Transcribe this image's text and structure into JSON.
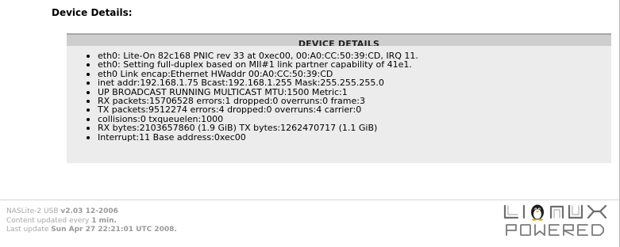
{
  "section_heading": "Device Details:",
  "box": {
    "title": "DEVICE DETAILS",
    "items": [
      "eth0: Lite-On 82c168 PNIC rev 33 at 0xec00, 00:A0:CC:50:39:CD, IRQ 11.",
      "eth0: Setting full-duplex based on MII#1 link partner capability of 41e1.",
      "eth0 Link encap:Ethernet HWaddr 00:A0:CC:50:39:CD",
      "inet addr:192.168.1.75 Bcast:192.168.1.255 Mask:255.255.255.0",
      "UP BROADCAST RUNNING MULTICAST MTU:1500 Metric:1",
      "RX packets:15706528 errors:1 dropped:0 overruns:0 frame:3",
      "TX packets:9512274 errors:4 dropped:0 overruns:4 carrier:0",
      "collisions:0 txqueuelen:1000",
      "RX bytes:2103657860 (1.9 GiB) TX bytes:1262470717 (1.1 GiB)",
      "Interrupt:11 Base address:0xec00"
    ]
  },
  "footer": {
    "product_prefix": "NASLite-2 USB",
    "version": "v2.03 12-2006",
    "update_prefix": "Content updated every",
    "update_interval": "1 min.",
    "last_update_prefix": "Last update",
    "last_update_value": "Sun Apr 27 22:21:01 UTC 2008."
  },
  "logo": {
    "top_text": "LINUX",
    "bottom_text": "POWERED",
    "icon": "tux-penguin-icon"
  }
}
